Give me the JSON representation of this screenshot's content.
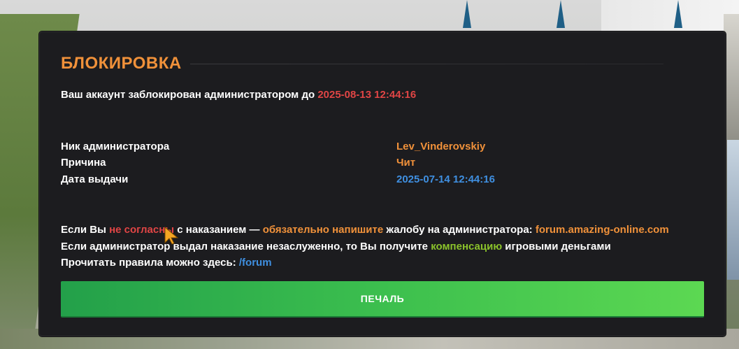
{
  "dialog": {
    "title": "БЛОКИРОВКА",
    "blocked_text": "Ваш аккаунт заблокирован администратором до ",
    "blocked_until": "2025-08-13 12:44:16",
    "details": [
      {
        "label": "Ник администратора",
        "value": "Lev_Vinderovskiy"
      },
      {
        "label": "Причина",
        "value": "Чит"
      },
      {
        "label": "Дата выдачи",
        "value": "2025-07-14 12:44:16"
      }
    ],
    "info_line1": {
      "part1": "Если Вы ",
      "highlight1": "не согласны",
      "part2": " с наказанием — ",
      "highlight2": "обязательно напишите",
      "part3": " жалобу на администратора: ",
      "link": "forum.amazing-online.com"
    },
    "info_line2": {
      "part1": "Если администратор выдал наказание незаслуженно, то Вы получите ",
      "highlight": "компенсацию",
      "part2": " игровыми деньгами"
    },
    "info_line3": {
      "text": "Прочитать правила можно здесь: ",
      "link": "/forum"
    },
    "print_button_label": "ПЕЧАЛЬ"
  },
  "colors": {
    "accent_orange": "#f0913a",
    "accent_red": "#e04545",
    "accent_blue": "#3f8fe0",
    "accent_green": "#8bc22b",
    "button_green": "#3cbf4e",
    "dialog_bg": "#1c1c1f"
  },
  "icons": {
    "cursor": "mouse-cursor-icon"
  }
}
